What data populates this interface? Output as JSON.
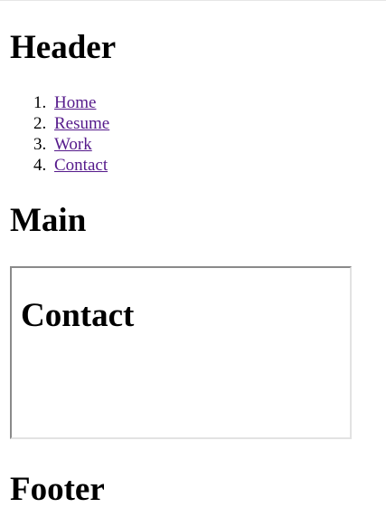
{
  "header": {
    "title": "Header"
  },
  "nav": {
    "items": [
      {
        "number": "1.",
        "label": "Home"
      },
      {
        "number": "2.",
        "label": "Resume"
      },
      {
        "number": "3.",
        "label": "Work"
      },
      {
        "number": "4.",
        "label": "Contact"
      }
    ],
    "link_color": "#551a8b"
  },
  "main": {
    "title": "Main",
    "frame": {
      "title": "Contact"
    }
  },
  "footer": {
    "title": "Footer"
  }
}
